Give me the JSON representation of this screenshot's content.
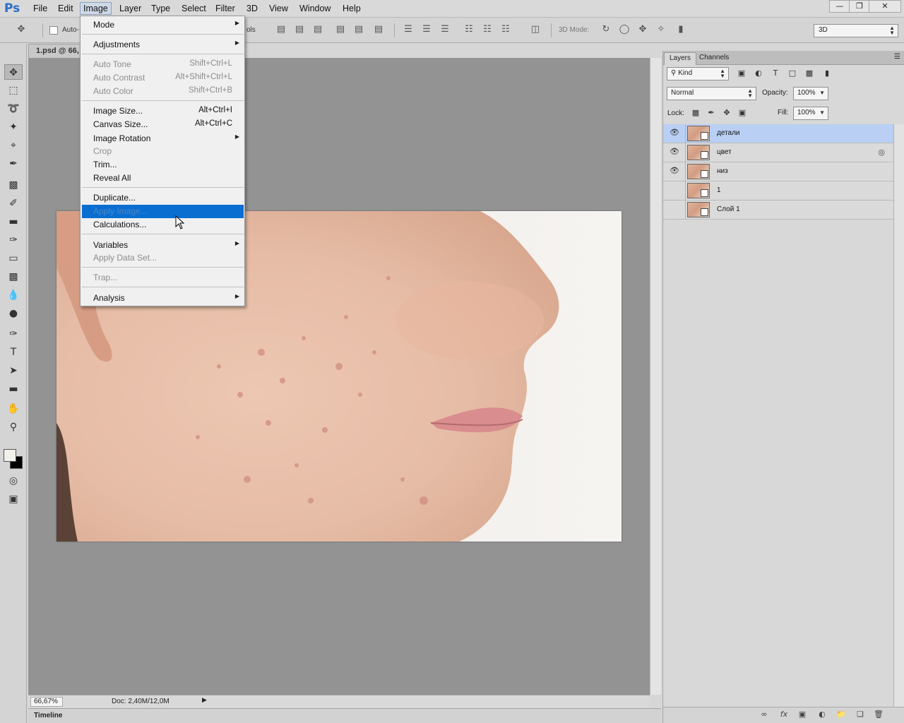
{
  "app": {
    "logo": "Ps",
    "menus": [
      "File",
      "Edit",
      "Image",
      "Layer",
      "Type",
      "Select",
      "Filter",
      "3D",
      "View",
      "Window",
      "Help"
    ],
    "active_menu": "Image",
    "window_controls": [
      "minimize-icon",
      "restore-icon",
      "close-icon"
    ]
  },
  "options_bar": {
    "auto_select_label": "Auto-",
    "controls_label": "ols",
    "mode_3d_label": "3D Mode:",
    "workspace": "3D"
  },
  "tools": [
    "move-tool-icon",
    "marquee-tool-icon",
    "lasso-tool-icon",
    "quick-select-icon",
    "crop-tool-icon",
    "eyedropper-icon",
    "spot-heal-icon",
    "brush-tool-icon",
    "clone-stamp-icon",
    "history-brush-icon",
    "eraser-icon",
    "gradient-icon",
    "blur-icon",
    "dodge-icon",
    "pen-tool-icon",
    "type-tool-icon",
    "path-select-icon",
    "rectangle-tool-icon",
    "hand-tool-icon",
    "zoom-tool-icon"
  ],
  "colors": {
    "foreground": "#f2f0ea",
    "background": "#000000",
    "menu_highlight": "#0a6ed1",
    "layer_selected": "#b9cff3"
  },
  "document": {
    "tab_label": "1.psd @ 66,",
    "zoom": "66,67%",
    "doc_info": "Doc: 2,40M/12,0M"
  },
  "image_menu": {
    "items": [
      {
        "label": "Mode",
        "shortcut": "",
        "submenu": true,
        "disabled": false
      },
      {
        "label": "Adjustments",
        "shortcut": "",
        "submenu": true,
        "disabled": false
      },
      {
        "label": "Auto Tone",
        "shortcut": "Shift+Ctrl+L",
        "submenu": false,
        "disabled": true
      },
      {
        "label": "Auto Contrast",
        "shortcut": "Alt+Shift+Ctrl+L",
        "submenu": false,
        "disabled": true
      },
      {
        "label": "Auto Color",
        "shortcut": "Shift+Ctrl+B",
        "submenu": false,
        "disabled": true
      },
      {
        "label": "Image Size...",
        "shortcut": "Alt+Ctrl+I",
        "submenu": false,
        "disabled": false
      },
      {
        "label": "Canvas Size...",
        "shortcut": "Alt+Ctrl+C",
        "submenu": false,
        "disabled": false
      },
      {
        "label": "Image Rotation",
        "shortcut": "",
        "submenu": true,
        "disabled": false
      },
      {
        "label": "Crop",
        "shortcut": "",
        "submenu": false,
        "disabled": true
      },
      {
        "label": "Trim...",
        "shortcut": "",
        "submenu": false,
        "disabled": false
      },
      {
        "label": "Reveal All",
        "shortcut": "",
        "submenu": false,
        "disabled": false
      },
      {
        "label": "Duplicate...",
        "shortcut": "",
        "submenu": false,
        "disabled": false
      },
      {
        "label": "Apply Image...",
        "shortcut": "",
        "submenu": false,
        "disabled": true,
        "highlighted": true
      },
      {
        "label": "Calculations...",
        "shortcut": "",
        "submenu": false,
        "disabled": false
      },
      {
        "label": "Variables",
        "shortcut": "",
        "submenu": true,
        "disabled": false
      },
      {
        "label": "Apply Data Set...",
        "shortcut": "",
        "submenu": false,
        "disabled": true
      },
      {
        "label": "Trap...",
        "shortcut": "",
        "submenu": false,
        "disabled": true
      },
      {
        "label": "Analysis",
        "shortcut": "",
        "submenu": true,
        "disabled": false
      }
    ]
  },
  "layers_panel": {
    "tabs": [
      "Layers",
      "Channels"
    ],
    "active_tab": "Layers",
    "filter_kind": "Kind",
    "blend_mode": "Normal",
    "opacity_label": "Opacity:",
    "opacity": "100%",
    "lock_label": "Lock:",
    "fill_label": "Fill:",
    "fill": "100%",
    "layers": [
      {
        "name": "детали",
        "visible": true,
        "selected": true
      },
      {
        "name": "цвет",
        "visible": true,
        "selected": false
      },
      {
        "name": "низ",
        "visible": true,
        "selected": false
      },
      {
        "name": "1",
        "visible": false,
        "selected": false
      },
      {
        "name": "Слой 1",
        "visible": false,
        "selected": false
      }
    ],
    "footer_icons": [
      "link-icon",
      "fx-icon",
      "mask-icon",
      "adjustment-icon",
      "group-icon",
      "new-layer-icon",
      "trash-icon"
    ]
  },
  "timeline": {
    "label": "Timeline"
  }
}
